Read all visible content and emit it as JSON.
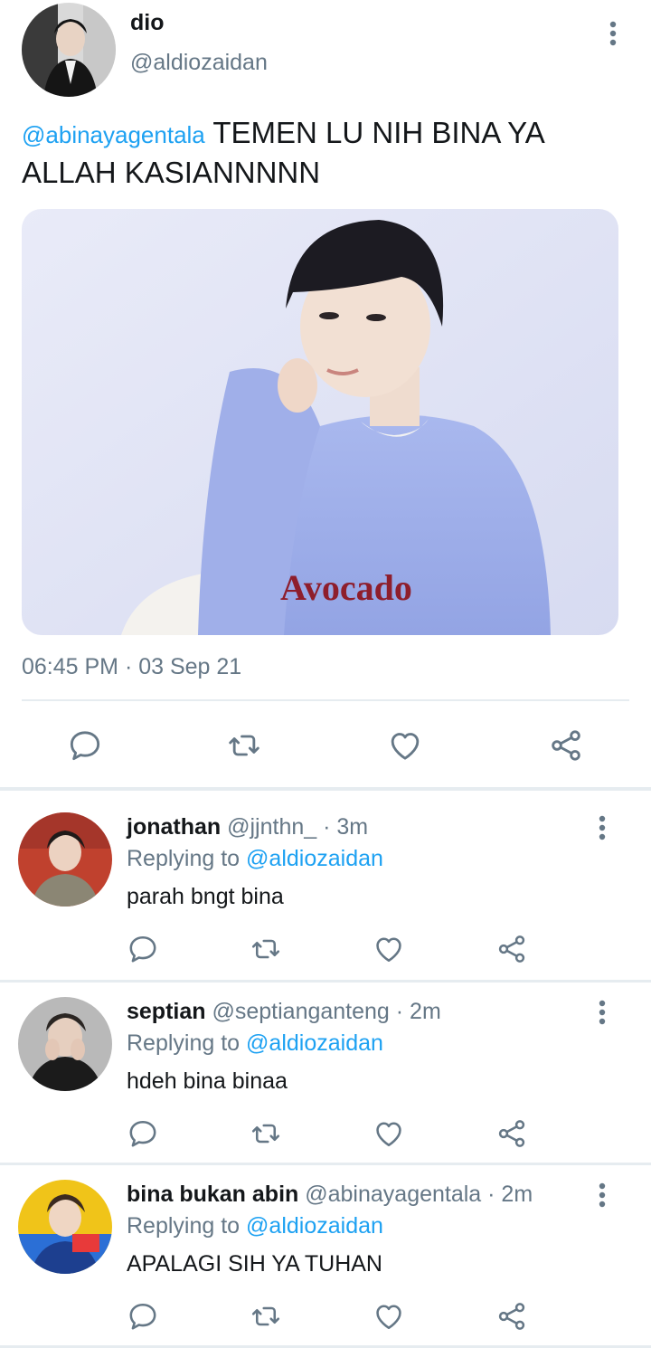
{
  "tweet": {
    "name": "dio",
    "handle": "@aldiozaidan",
    "mention": "@abinayagentala",
    "text": " TEMEN LU NIH BINA YA ALLAH KASIANNNNN",
    "timestamp": "06:45 PM · 03 Sep 21",
    "media_caption": "Avocado",
    "actions": [
      "reply-icon",
      "retweet-icon",
      "like-icon",
      "share-icon"
    ]
  },
  "replies": [
    {
      "name": "jonathan",
      "meta": " @jjnthn_ · 3m",
      "replying_prefix": "Replying to ",
      "replying_handle": "@aldiozaidan",
      "text": "parah bngt bina"
    },
    {
      "name": "septian",
      "meta": " @septianganteng · 2m",
      "replying_prefix": "Replying to ",
      "replying_handle": "@aldiozaidan",
      "text": "hdeh bina binaa"
    },
    {
      "name": "bina bukan abin",
      "meta": " @abinayagentala · 2m",
      "replying_prefix": "Replying to ",
      "replying_handle": "@aldiozaidan",
      "text": "APALAGI SIH YA TUHAN"
    }
  ],
  "colors": {
    "accent": "#1da1f2",
    "secondary_text": "#657786",
    "icon": "#657786",
    "divider": "#e6ecf0"
  }
}
